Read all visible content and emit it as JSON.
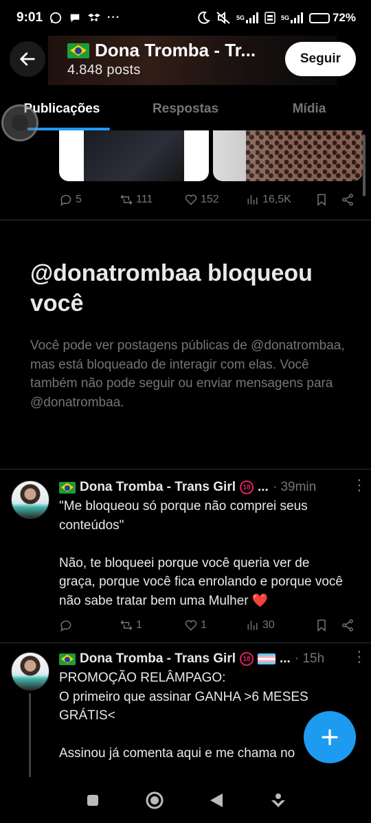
{
  "status_bar": {
    "time": "9:01",
    "battery_percent": "72%",
    "battery_level": 0.72,
    "network_1": "5G",
    "network_2": "5G",
    "left_icons": [
      "whatsapp-icon",
      "chat-icon",
      "dropbox-icon",
      "more-icon"
    ],
    "right_icons": [
      "moon-icon",
      "mute-icon",
      "signal-icon",
      "volte-icon",
      "signal-icon",
      "battery-icon"
    ]
  },
  "header": {
    "title": "Dona Tromba - Tr...",
    "posts": "4.848 posts",
    "follow_label": "Seguir"
  },
  "tabs": [
    {
      "label": "Publicações",
      "active": true
    },
    {
      "label": "Respostas",
      "active": false
    },
    {
      "label": "Mídia",
      "active": false
    }
  ],
  "first_tweet": {
    "replies": "5",
    "retweets": "111",
    "likes": "152",
    "views": "16,5K"
  },
  "blocked": {
    "title": "@donatrombaa bloqueou você",
    "body": "Você pode ver postagens públicas de @donatrombaa, mas está bloqueado de interagir com elas. Você também não pode seguir ou enviar mensagens para @donatrombaa."
  },
  "tweets": [
    {
      "name": "Dona Tromba - Trans Girl",
      "time": "· 39min",
      "text": "\"Me bloqueou só porque não comprei seus conteúdos\"\n\nNão, te bloqueei porque você queria ver de graça, porque você fica enrolando e porque você não sabe tratar bem uma Mulher",
      "replies": "",
      "retweets": "1",
      "likes": "1",
      "views": "30"
    },
    {
      "name": "Dona Tromba - Trans Girl",
      "time": "· 15h",
      "text": "PROMOÇÃO RELÂMPAGO:\nO primeiro que assinar GANHA >6 MESES GRÁTIS<\n\nAssinou já comenta aqui e me chama no"
    }
  ],
  "colors": {
    "accent": "#1d9bf0",
    "background": "#000000",
    "muted_text": "#71767b",
    "divider": "#2f3336"
  }
}
